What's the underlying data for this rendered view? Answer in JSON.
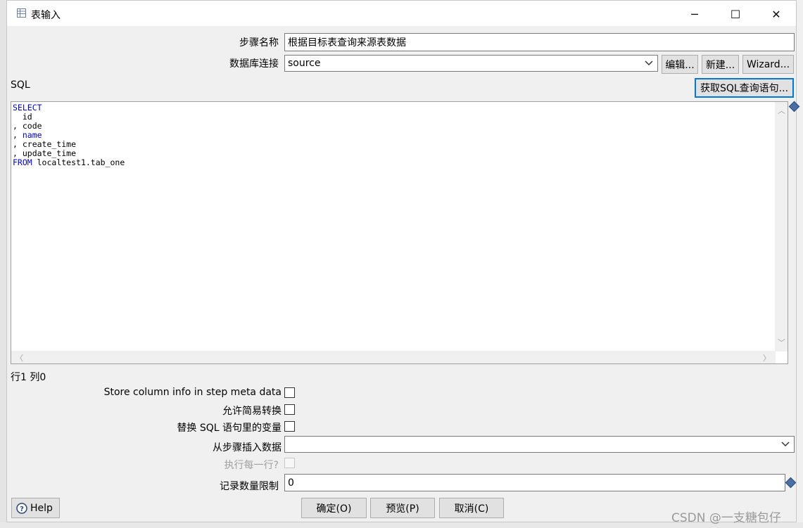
{
  "window": {
    "title": "表输入",
    "minimize_glyph": "─",
    "maximize_glyph": "☐",
    "close_glyph": "✕"
  },
  "form": {
    "step_name_label": "步骤名称",
    "step_name_value": "根据目标表查询来源表数据",
    "db_conn_label": "数据库连接",
    "db_conn_value": "source",
    "edit_button": "编辑...",
    "new_button": "新建...",
    "wizard_button": "Wizard...",
    "sql_label": "SQL",
    "get_sql_button": "获取SQL查询语句...",
    "sql_lines": [
      {
        "kw": "SELECT",
        "rest": ""
      },
      {
        "kw": "",
        "rest": "  id"
      },
      {
        "kw": "",
        "rest": ", code"
      },
      {
        "kw": "",
        "rest": ", ",
        "kw2": "name"
      },
      {
        "kw": "",
        "rest": ", create_time"
      },
      {
        "kw": "",
        "rest": ", update_time"
      },
      {
        "kw": "FROM",
        "rest": " localtest1.tab_one"
      }
    ],
    "cursor_pos": "行1 列0",
    "store_column_label": "Store column info in step meta data",
    "lazy_conversion_label": "允许简易转换",
    "replace_vars_label": "替换 SQL 语句里的变量",
    "insert_from_step_label": "从步骤插入数据",
    "insert_from_step_value": "",
    "execute_each_row_label": "执行每一行?",
    "limit_label": "记录数量限制",
    "limit_value": "0"
  },
  "footer": {
    "help_button": "Help",
    "ok_button": "确定(O)",
    "preview_button": "预览(P)",
    "cancel_button": "取消(C)"
  },
  "watermark": "CSDN @一支糖包仔",
  "icons": {
    "help": "help-icon",
    "variable": "variable-diamond-icon",
    "dropdown": "chevron-down-icon"
  },
  "colors": {
    "accent": "#0078d7",
    "sql_keyword": "#0000c8"
  }
}
